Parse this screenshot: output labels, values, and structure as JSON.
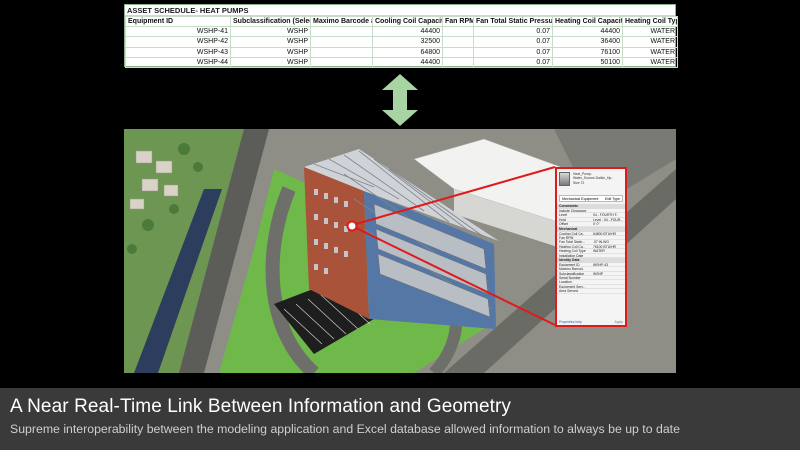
{
  "schedule": {
    "title": "ASSET SCHEDULE- HEAT PUMPS",
    "columns": [
      "Equipment ID",
      "Subclassification (Select)",
      "Maximo Barcode #",
      "Cooling Coil Capacity",
      "Fan RPM",
      "Fan Total Static Pressure",
      "Heating Coil Capacity",
      "Heating Coil Type"
    ],
    "rows": [
      [
        "WSHP-41",
        "WSHP",
        "",
        "44400",
        "",
        "0.07",
        "44400",
        "WATER"
      ],
      [
        "WSHP-42",
        "WSHP",
        "",
        "32500",
        "",
        "0.07",
        "36400",
        "WATER"
      ],
      [
        "WSHP-43",
        "WSHP",
        "",
        "64800",
        "",
        "0.07",
        "76100",
        "WATER"
      ],
      [
        "WSHP-44",
        "WSHP",
        "",
        "44400",
        "",
        "0.07",
        "50100",
        "WATER"
      ]
    ]
  },
  "properties": {
    "type_lines": [
      "Heat_Pump-",
      "Water_Source-Daikin_Hp..",
      "Size 72"
    ],
    "selector": "Mechanical Equipment",
    "edit_type": "Edit Type",
    "rows": [
      {
        "kind": "sect",
        "k": "Constraints",
        "v": ""
      },
      {
        "kind": "row",
        "k": "Include Clearance",
        "v": ""
      },
      {
        "kind": "row",
        "k": "Level",
        "v": "04 - FOURTH F.."
      },
      {
        "kind": "row",
        "k": "Host",
        "v": "Level : 04 - FOUR.."
      },
      {
        "kind": "row",
        "k": "Offset",
        "v": "0' 0\""
      },
      {
        "kind": "sect",
        "k": "Mechanical",
        "v": ""
      },
      {
        "kind": "row",
        "k": "Cooling Coil Ca..",
        "v": "64800 BTU/HR"
      },
      {
        "kind": "row",
        "k": "Fan RPM",
        "v": ""
      },
      {
        "kind": "row",
        "k": "Fan Total Static ..",
        "v": ".07 IN-WG"
      },
      {
        "kind": "row",
        "k": "Heating Coil Ca..",
        "v": "76100 BTU/HR"
      },
      {
        "kind": "row",
        "k": "Heating Coil Type",
        "v": "WATER"
      },
      {
        "kind": "row",
        "k": "Installation Date",
        "v": ""
      },
      {
        "kind": "sect",
        "k": "Identity Data",
        "v": ""
      },
      {
        "kind": "row",
        "k": "Equipment ID",
        "v": "WSHP-43"
      },
      {
        "kind": "row",
        "k": "Maximo Barcod..",
        "v": ""
      },
      {
        "kind": "row",
        "k": "Subclassification",
        "v": "WSHP"
      },
      {
        "kind": "row",
        "k": "Serial Number",
        "v": ""
      },
      {
        "kind": "row",
        "k": "Location",
        "v": ""
      },
      {
        "kind": "row",
        "k": "Equipment Serv..",
        "v": ""
      },
      {
        "kind": "row",
        "k": "Area Served",
        "v": ""
      }
    ],
    "help_link": "Properties help",
    "apply_label": "Apply"
  },
  "caption": {
    "title": "A Near Real-Time  Link Between  Information  and Geometry",
    "subtitle": "Supreme interoperability between the modeling application and Excel database allowed information to always be up to date"
  },
  "colors": {
    "arrow": "#a8d4a4",
    "callout": "#e01a1a",
    "caption_bg": "#3a3a3a",
    "brick": "#a9533b",
    "grass": "#6fb84a"
  }
}
